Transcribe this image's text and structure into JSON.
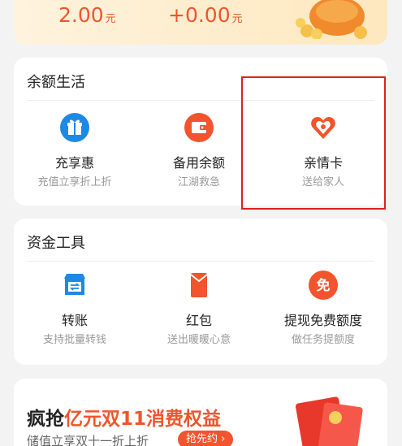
{
  "balance": {
    "amount1": "2.00",
    "amount2": "+0.00",
    "unit": "元"
  },
  "section1": {
    "title": "余额生活",
    "items": [
      {
        "label": "充享惠",
        "sub": "充值立享折上折",
        "icon": "gift-box-icon"
      },
      {
        "label": "备用余额",
        "sub": "江湖救急",
        "icon": "wallet-icon"
      },
      {
        "label": "亲情卡",
        "sub": "送给家人",
        "icon": "heart-icon"
      }
    ]
  },
  "section2": {
    "title": "资金工具",
    "items": [
      {
        "label": "转账",
        "sub": "支持批量转钱",
        "icon": "transfer-store-icon"
      },
      {
        "label": "红包",
        "sub": "送出暖暖心意",
        "icon": "red-envelope-icon"
      },
      {
        "label": "提现免费额度",
        "sub": "做任务提额度",
        "icon": "free-badge-icon"
      }
    ]
  },
  "free_badge_char": "免",
  "promo": {
    "title_prefix": "疯抢",
    "title_highlight": "亿元双11消费权益",
    "sub": "储值立享双十一折上折",
    "button": "抢先约 ›"
  },
  "colors": {
    "accent": "#f2542d",
    "icon_blue": "#1e88e5",
    "highlight_box": "#e02020"
  }
}
